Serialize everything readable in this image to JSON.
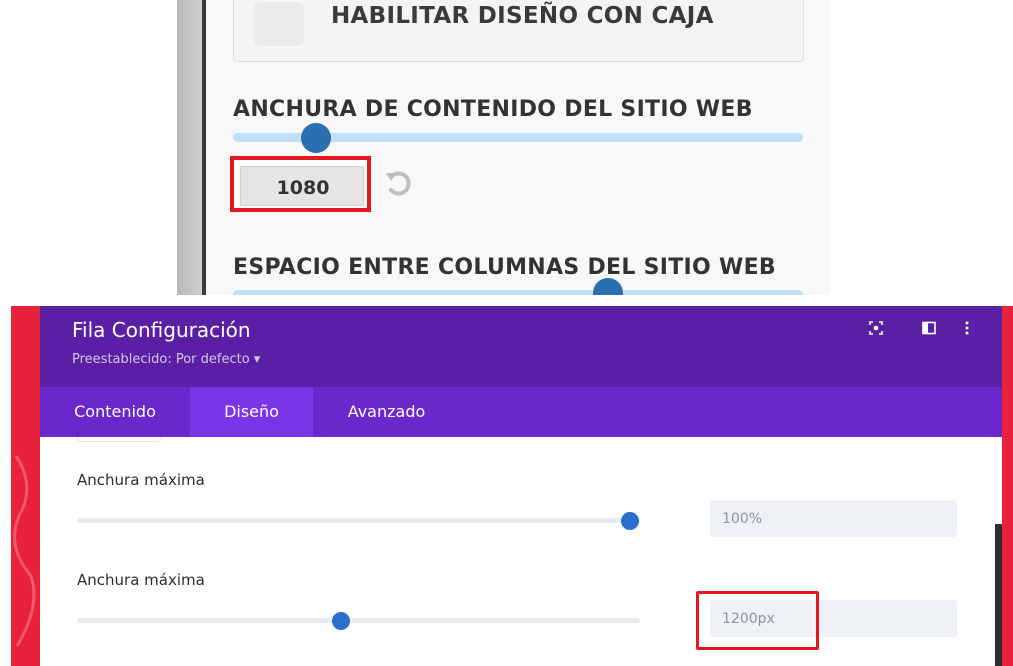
{
  "customizer": {
    "boxed_layout_label": "HABILITAR DISEÑO CON CAJA",
    "content_width_label": "ANCHURA DE CONTENIDO DEL SITIO WEB",
    "content_width_value": "1080",
    "column_gap_label": "ESPACIO ENTRE COLUMNAS DEL SITIO WEB",
    "accent_color": "#2a6fb0",
    "highlight_color": "#e0191f"
  },
  "modal": {
    "title": "Fila Configuración",
    "preset": "Preestablecido: Por defecto ▾",
    "header_color": "#5b1fa5",
    "tabs": [
      {
        "label": "Contenido",
        "active": false
      },
      {
        "label": "Diseño",
        "active": true
      },
      {
        "label": "Avanzado",
        "active": false
      }
    ],
    "fields": [
      {
        "label": "Anchura máxima",
        "value": "100%",
        "slider_fraction": 1.0
      },
      {
        "label": "Anchura máxima",
        "value": "1200px",
        "slider_fraction": 0.46
      }
    ],
    "header_icons": [
      "focus-icon",
      "split-view-icon",
      "more-options-icon"
    ]
  }
}
